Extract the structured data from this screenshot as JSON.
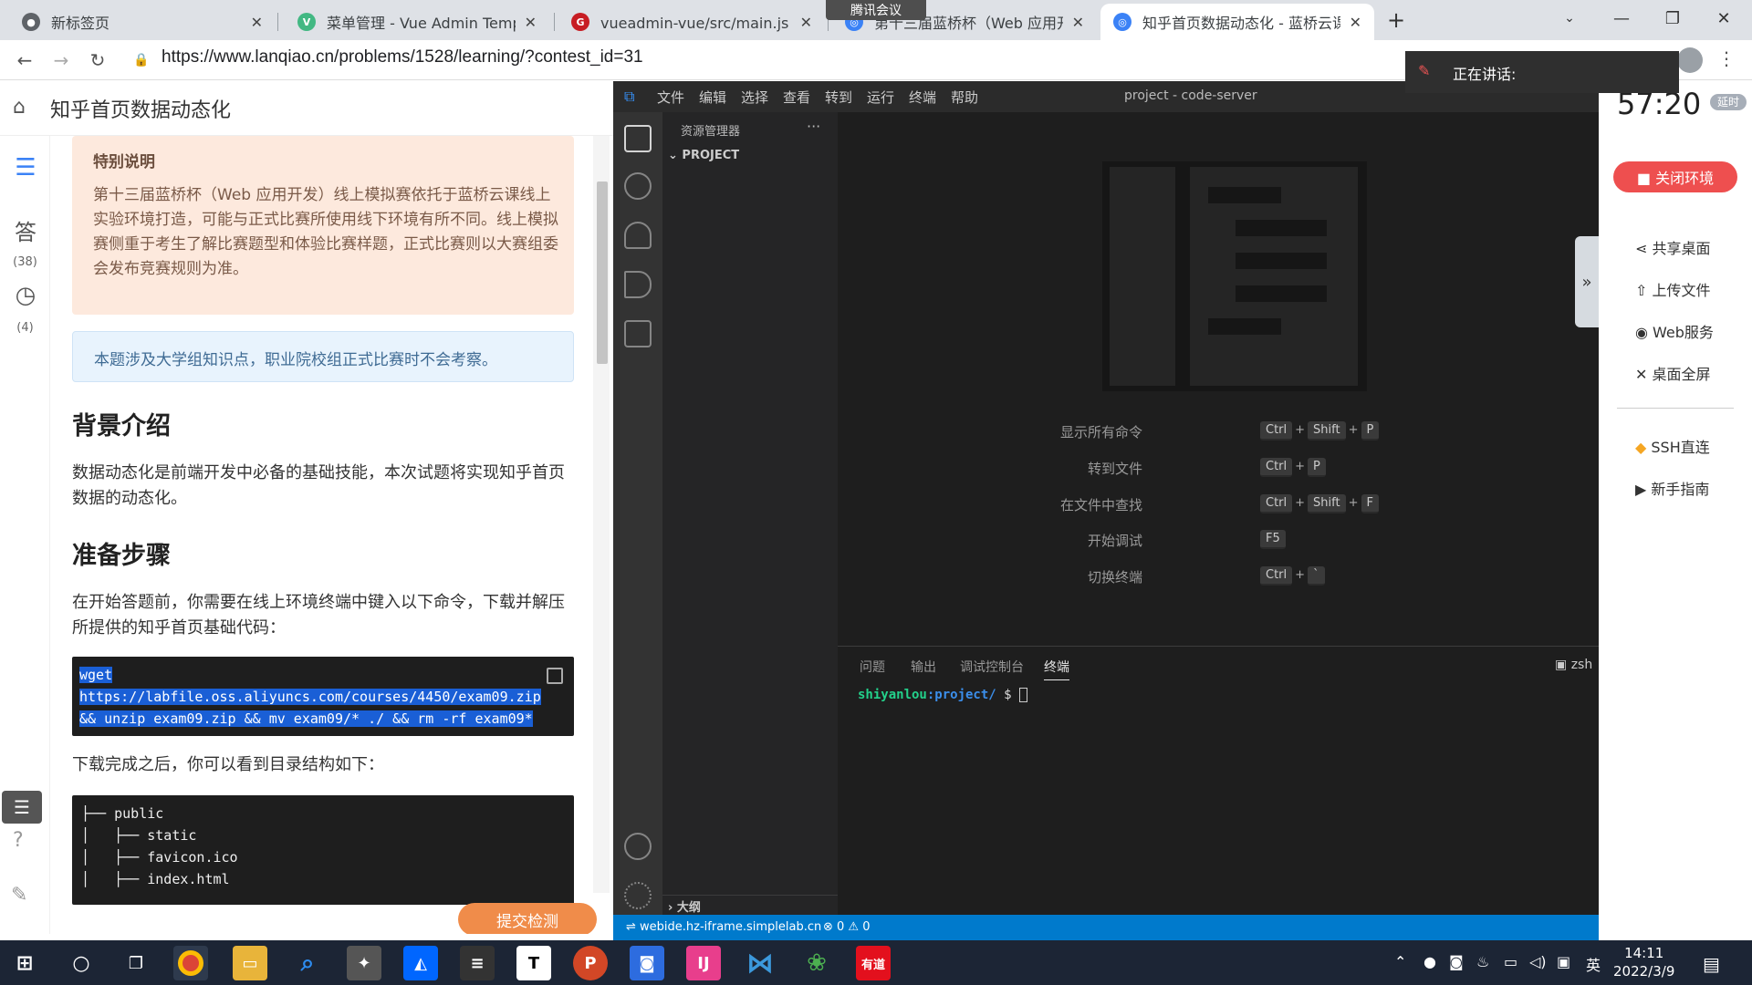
{
  "browser": {
    "tabs": [
      {
        "title": "新标签页",
        "icon": "chrome-icon",
        "color": "#5f6368"
      },
      {
        "title": "菜单管理 - Vue Admin Templat",
        "icon": "vue-icon",
        "color": "#42b883"
      },
      {
        "title": "vueadmin-vue/src/main.js · 谢",
        "icon": "gitee-icon",
        "color": "#c71d23"
      },
      {
        "title": "第十三届蓝桥杯（Web 应用开发",
        "icon": "lanqiao-icon",
        "color": "#3b82f6"
      },
      {
        "title": "知乎首页数据动态化 - 蓝桥云课",
        "icon": "lanqiao-icon",
        "color": "#3b82f6"
      }
    ],
    "url": "https://www.lanqiao.cn/problems/1528/learning/?contest_id=31",
    "new_tab": "+",
    "close_glyph": "✕"
  },
  "meeting": {
    "app": "腾讯会议",
    "speaking": "正在讲话:"
  },
  "lesson": {
    "title": "知乎首页数据动态化",
    "rail": {
      "answers_label": "答",
      "answers_count": "(38)",
      "history_count": "(4)"
    },
    "note_special": {
      "title": "特别说明",
      "body": "第十三届蓝桥杯（Web 应用开发）线上模拟赛依托于蓝桥云课线上实验环境打造，可能与正式比赛所使用线下环境有所不同。线上模拟赛侧重于考生了解比赛题型和体验比赛样题，正式比赛则以大赛组委会发布竞赛规则为准。"
    },
    "note_info": "本题涉及大学组知识点，职业院校组正式比赛时不会考察。",
    "h_background": "背景介绍",
    "p_background": "数据动态化是前端开发中必备的基础技能，本次试题将实现知乎首页数据的动态化。",
    "h_prepare": "准备步骤",
    "p_prepare": "在开始答题前，你需要在线上环境终端中键入以下命令，下载并解压所提供的知乎首页基础代码：",
    "cmd_lines": [
      "wget ",
      "https://labfile.oss.aliyuncs.com/courses/4450/exam09.zip",
      "&& unzip exam09.zip && mv exam09/* ./ && rm -rf exam09*"
    ],
    "p_after": "下载完成之后，你可以看到目录结构如下：",
    "tree_lines": [
      "├── public",
      "│   ├── static",
      "│   ├── favicon.ico",
      "│   ├── index.html"
    ],
    "submit": "提交检测"
  },
  "vscode": {
    "menu": [
      "文件",
      "编辑",
      "选择",
      "查看",
      "转到",
      "运行",
      "终端",
      "帮助"
    ],
    "title": "project - code-server",
    "explorer_title": "资源管理器",
    "explorer_more": "···",
    "project": "PROJECT",
    "outline": "大纲",
    "shortcuts": [
      {
        "label": "显示所有命令",
        "keys": [
          "Ctrl",
          "+",
          "Shift",
          "+",
          "P"
        ]
      },
      {
        "label": "转到文件",
        "keys": [
          "Ctrl",
          "+",
          "P"
        ]
      },
      {
        "label": "在文件中查找",
        "keys": [
          "Ctrl",
          "+",
          "Shift",
          "+",
          "F"
        ]
      },
      {
        "label": "开始调试",
        "keys": [
          "F5"
        ]
      },
      {
        "label": "切换终端",
        "keys": [
          "Ctrl",
          "+",
          "`"
        ]
      }
    ],
    "panel_tabs": [
      "问题",
      "输出",
      "调试控制台",
      "终端"
    ],
    "active_panel": "终端",
    "shell": "zsh",
    "prompt_user": "shiyanlou",
    "prompt_path": ":project/",
    "prompt_sign": " $",
    "status_remote": "webide.hz-iframe.simplelab.cn",
    "status_problems": "⊗ 0 ⚠ 0"
  },
  "env_panel": {
    "timer": "57:20",
    "extend": "延时",
    "close_env": "■ 关闭环境",
    "items": [
      "共享桌面",
      "上传文件",
      "Web服务",
      "桌面全屏"
    ],
    "items2": [
      "SSH直连",
      "新手指南"
    ]
  },
  "taskbar": {
    "time": "14:11",
    "date": "2022/3/9",
    "ime": "英"
  }
}
